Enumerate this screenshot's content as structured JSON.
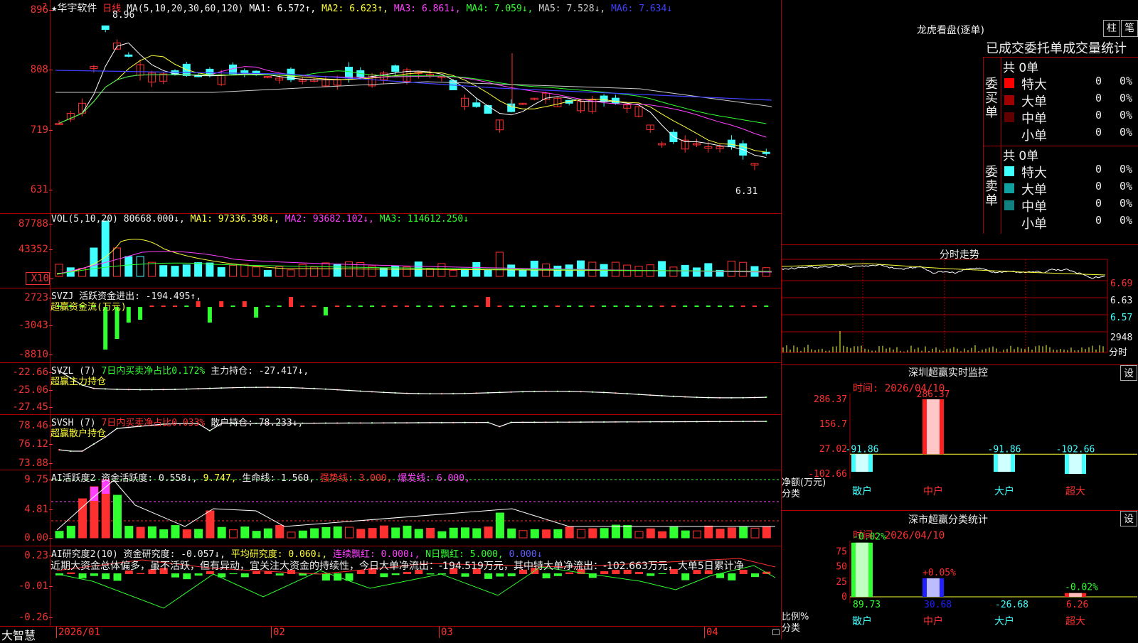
{
  "stock": {
    "name": "★华宇软件",
    "period": "日线",
    "high_mark": "8.96",
    "low_mark": "6.31",
    "corner_mark": "?"
  },
  "main": {
    "ticks": [
      "896",
      "808",
      "719",
      "631"
    ],
    "ma_label": "MA(5,10,20,30,60,120)",
    "ma": [
      {
        "text": "MA1: 6.572↑,",
        "color": "#ffffff"
      },
      {
        "text": "MA2: 6.623↑,",
        "color": "#ffff3a"
      },
      {
        "text": "MA3: 6.861↓,",
        "color": "#ff40ff"
      },
      {
        "text": "MA4: 7.059↓,",
        "color": "#30ff30"
      },
      {
        "text": "MA5: 7.528↓,",
        "color": "#cccccc"
      },
      {
        "text": "MA6: 7.634↓",
        "color": "#4040ff"
      }
    ]
  },
  "vol": {
    "ticks": [
      "87788",
      "43352",
      "X10"
    ],
    "label": "VOL(5,10,20)",
    "value": "80668.000↓,",
    "ma1": "MA1: 97336.398↓,",
    "ma2": "MA2: 93682.102↓,",
    "ma3": "MA3: 114612.250↓"
  },
  "svzj": {
    "ticks": [
      "2723",
      "-3043",
      "-8810"
    ],
    "label": "SVZJ  活跃资金进出: -194.495↑,",
    "sub": "超赢资金流(万元)"
  },
  "svzl": {
    "ticks": [
      "-22.66",
      "-25.06",
      "-27.45"
    ],
    "label": "SVZL (7)",
    "net": "7日内买卖净占比0.172%",
    "hold": "主力持仓: -27.417↓,",
    "sub": "超赢主力持仓"
  },
  "svsh": {
    "ticks": [
      "78.46",
      "76.12",
      "73.88"
    ],
    "label": "SVSH (7)",
    "net": "7日内买卖净占比0.033%",
    "hold": "散户持仓: 78.233↓,",
    "sub": "超赢散户持仓"
  },
  "ai1": {
    "ticks": [
      "9.75",
      "4.81",
      "0.00"
    ],
    "label": "AI活跃度2",
    "act": "资金活跃度: 0.558↓,",
    "v2": "9.747,",
    "life": "生命线: 1.560,",
    "strong": "强势线: 3.000,",
    "burst": "爆发线: 6.000,"
  },
  "ai2": {
    "ticks": [
      "0.23",
      "-0.01",
      "-0.26"
    ],
    "label": "AI研究度2(10)",
    "res": "资金研究度: -0.057↓,",
    "avg": "平均研究度: 0.060↓,",
    "lian": "连续飘红: 0.000↓,",
    "nday": "N日飘红: 5.000,",
    "last": "0.000↓",
    "comment": "近期大资金总体偏多，虽不活跃，但有异动，宜关注大资金的持续性，今日大单净流出：-194.519万元，其中特大单净流出：-102.663万元，大单5日累计净"
  },
  "dates": {
    "d0": "2026/01",
    "d1": "02",
    "d2": "03",
    "d3": "04"
  },
  "brand": "大智慧",
  "lhb": {
    "title": "龙虎看盘(逐单)",
    "btn1": "柱",
    "btn2": "笔",
    "sub_title": "已成交委托单成交量统计",
    "buy_label": "委买单",
    "sell_label": "委卖单",
    "buy_total": "共 0单",
    "sell_total": "共 0单",
    "buy_rows": [
      {
        "name": "特大",
        "count": "0",
        "pct": "0%",
        "color": "#ff0000"
      },
      {
        "name": "大单",
        "count": "0",
        "pct": "0%",
        "color": "#a00000"
      },
      {
        "name": "中单",
        "count": "0",
        "pct": "0%",
        "color": "#600000"
      },
      {
        "name": "小单",
        "count": "0",
        "pct": "0%",
        "color": ""
      }
    ],
    "sell_rows": [
      {
        "name": "特大",
        "count": "0",
        "pct": "0%",
        "color": "#40ffff"
      },
      {
        "name": "大单",
        "count": "0",
        "pct": "0%",
        "color": "#10a0a0"
      },
      {
        "name": "中单",
        "count": "0",
        "pct": "0%",
        "color": "#108080"
      },
      {
        "name": "小单",
        "count": "0",
        "pct": "0%",
        "color": ""
      }
    ]
  },
  "fenshi": {
    "title": "分时走势",
    "p1": "6.69",
    "p2": "6.63",
    "p3": "6.57",
    "vol": "2948",
    "unit": "分时"
  },
  "sz_monitor": {
    "title": "深圳超赢实时监控",
    "btn": "设",
    "time": "时间: 2026/04/10",
    "ticks": [
      "286.37",
      "156.7",
      "27.02",
      "-102.66"
    ],
    "ylabel": "净额(万元)",
    "xlabel": "分类",
    "categories": [
      "散户",
      "中户",
      "大户",
      "超大"
    ],
    "values": [
      -91.86,
      286.37,
      -91.86,
      -102.66
    ],
    "value_labels": [
      "-91.86",
      "286.37",
      "-91.86",
      "-102.66"
    ]
  },
  "sz_class": {
    "title": "深市超赢分类统计",
    "btn": "设",
    "time": "时间: 2026/04/10",
    "ticks": [
      "75",
      "50",
      "25",
      "0"
    ],
    "ylabel": "比例%",
    "xlabel": "分类",
    "categories": [
      "散户",
      "中户",
      "大户",
      "超大"
    ],
    "top_labels": [
      "-0.02%",
      "+0.05%",
      "",
      "-0.02%"
    ],
    "bottom_labels": [
      "89.73",
      "30.68",
      "-26.68",
      "6.26"
    ],
    "values": [
      89.73,
      30.68,
      0,
      6.26
    ]
  }
}
